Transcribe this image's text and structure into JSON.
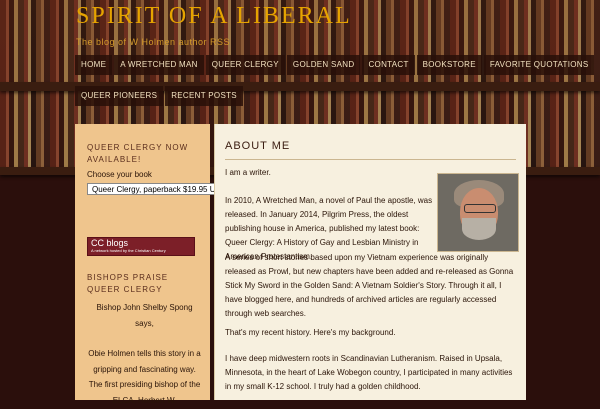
{
  "site": {
    "title": "SPIRIT OF A LIBERAL",
    "tagline": "The blog of W Holmen author RSS"
  },
  "nav": {
    "row1": [
      "HOME",
      "A WRETCHED MAN",
      "QUEER CLERGY",
      "GOLDEN SAND",
      "CONTACT",
      "BOOKSTORE",
      "FAVORITE QUOTATIONS"
    ],
    "row2": [
      "QUEER PIONEERS",
      "RECENT POSTS"
    ]
  },
  "sidebar": {
    "heading1": "QUEER CLERGY NOW AVAILABLE!",
    "choose_label": "Choose your book",
    "select_value": "Queer Clergy, paperback $19.95 USD",
    "ccblogs": "CC blogs",
    "ccblogs_sub": "A network hosted by the Christian Century",
    "heading2": "BISHOPS PRAISE QUEER CLERGY",
    "quote1": "Bishop John Shelby Spong says,",
    "quote2": "Obie Holmen tells this story in a gripping and fascinating way.",
    "quote3": "The first presiding bishop of the ELCA, Herbert W."
  },
  "main": {
    "heading": "ABOUT ME",
    "p1": "I am a writer.",
    "p2": "In 2010, A Wretched Man, a novel of Paul the apostle, was released. In January 2014, Pilgrim Press, the oldest publishing house in America, published my latest book: Queer Clergy: A History of Gay and Lesbian Ministry in American Protestantism.",
    "p3": "A series of short stories based upon my Vietnam experience was originally released as Prowl, but new chapters have been added and re-released as Gonna Stick My Sword in the Golden Sand: A Vietnam Soldier's Story. Through it all, I have blogged here, and hundreds of archived articles are regularly accessed through web searches.",
    "p4": "That's my recent history. Here's my background.",
    "p5": "I have deep midwestern roots in Scandinavian Lutheranism. Raised in Upsala, Minnesota, in the heart of Lake Wobegon country, I participated in many activities in my small K-12 school. I truly had a golden childhood."
  }
}
